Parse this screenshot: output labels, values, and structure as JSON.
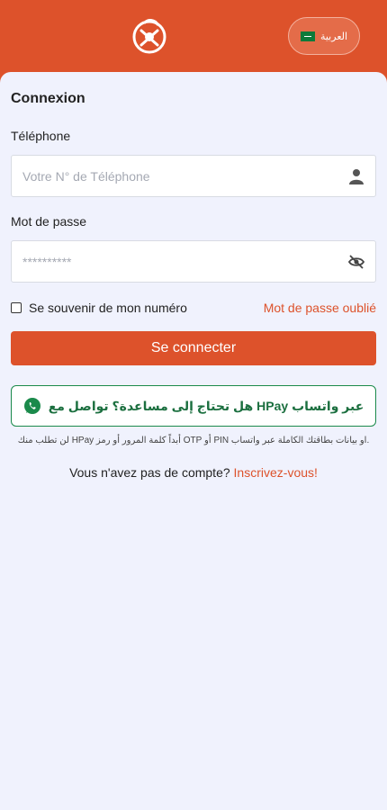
{
  "header": {
    "language_label": "العربية",
    "flag_icon": "saudi-flag-icon",
    "logo_icon": "brand-logo-icon"
  },
  "login": {
    "title": "Connexion",
    "phone": {
      "label": "Téléphone",
      "placeholder": "Votre N° de Téléphone",
      "icon": "user-icon"
    },
    "password": {
      "label": "Mot de passe",
      "placeholder": "**********",
      "icon": "eye-off-icon"
    },
    "remember_label": "Se souvenir de mon numéro",
    "remember_checked": false,
    "forgot_label": "Mot de passe oublié",
    "submit_label": "Se connecter"
  },
  "whatsapp": {
    "label": "عبر واتساب HPay هل تحتاج إلى مساعدة؟ تواصل مع",
    "icon": "whatsapp-icon",
    "notice": ".او بيانات بطاقتك الكاملة عبر واتساب PIN أو OTP أبداً كلمة المرور أو رمز HPay لن تطلب منك"
  },
  "signup": {
    "prompt": "Vous n'avez pas de compte? ",
    "link_label": "Inscrivez-vous!"
  },
  "colors": {
    "brand": "#dd522b",
    "background": "#f0f2fd",
    "whatsapp_green": "#1b8a4b"
  }
}
